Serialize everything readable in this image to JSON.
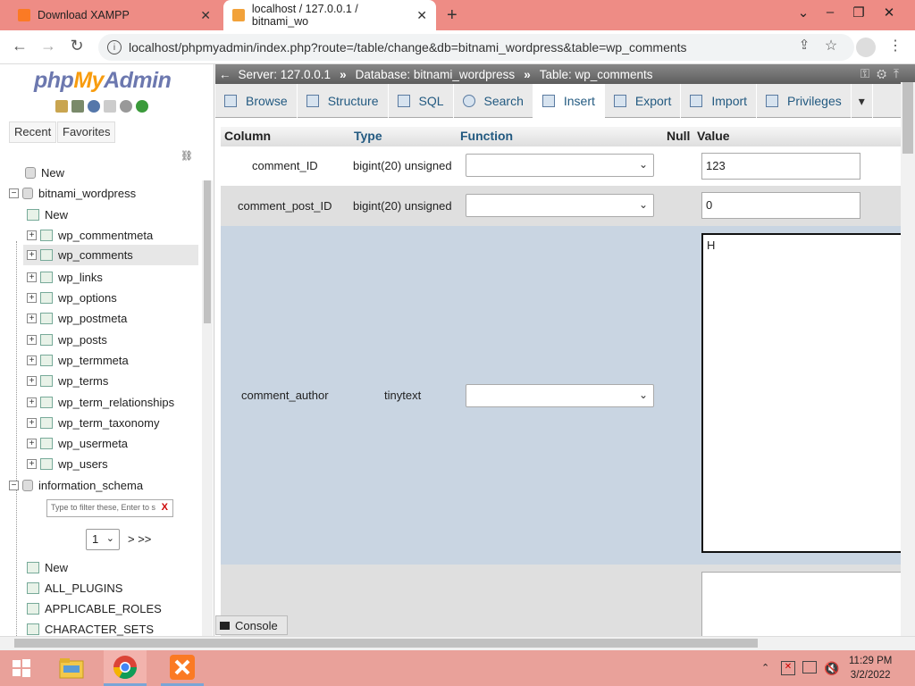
{
  "browser": {
    "tabs": [
      {
        "title": "Download XAMPP",
        "close": "✕"
      },
      {
        "title": "localhost / 127.0.0.1 / bitnami_wo",
        "close": "✕"
      }
    ],
    "new_tab": "+",
    "url": "localhost/phpmyadmin/index.php?route=/table/change&db=bitnami_wordpress&table=wp_comments",
    "window_controls": [
      "⌄",
      "–",
      "❐",
      "✕"
    ]
  },
  "pma": {
    "logo": {
      "php": "php",
      "my": "My",
      "admin": "Admin"
    },
    "nav_buttons": [
      "Recent",
      "Favorites"
    ],
    "tree": [
      {
        "label": "New",
        "level": 0
      },
      {
        "label": "bitnami_wordpress",
        "level": 0
      },
      {
        "label": "New",
        "level": 1
      },
      {
        "label": "wp_commentmeta",
        "level": 1
      },
      {
        "label": "wp_comments",
        "level": 1
      },
      {
        "label": "wp_links",
        "level": 1
      },
      {
        "label": "wp_options",
        "level": 1
      },
      {
        "label": "wp_postmeta",
        "level": 1
      },
      {
        "label": "wp_posts",
        "level": 1
      },
      {
        "label": "wp_termmeta",
        "level": 1
      },
      {
        "label": "wp_terms",
        "level": 1
      },
      {
        "label": "wp_term_relationships",
        "level": 1
      },
      {
        "label": "wp_term_taxonomy",
        "level": 1
      },
      {
        "label": "wp_usermeta",
        "level": 1
      },
      {
        "label": "wp_users",
        "level": 1
      },
      {
        "label": "information_schema",
        "level": 0
      }
    ],
    "filter_placeholder": "Type to filter these, Enter to s",
    "filter_clear": "X",
    "page_select": "1",
    "page_next": "> >>",
    "tree2": [
      {
        "label": "New"
      },
      {
        "label": "ALL_PLUGINS"
      },
      {
        "label": "APPLICABLE_ROLES"
      },
      {
        "label": "CHARACTER_SETS"
      }
    ],
    "breadcrumb": {
      "server": "Server: 127.0.0.1",
      "database": "Database: bitnami_wordpress",
      "table": "Table: wp_comments",
      "sep": "»"
    },
    "tabs": [
      "Browse",
      "Structure",
      "SQL",
      "Search",
      "Insert",
      "Export",
      "Import",
      "Privileges"
    ],
    "active_tab": "Insert",
    "columns_header": {
      "column": "Column",
      "type": "Type",
      "function": "Function",
      "null": "Null",
      "value": "Value"
    },
    "rows": [
      {
        "column": "comment_ID",
        "type": "bigint(20) unsigned",
        "function": "",
        "value": "123"
      },
      {
        "column": "comment_post_ID",
        "type": "bigint(20) unsigned",
        "function": "",
        "value": "0"
      },
      {
        "column": "comment_author",
        "type": "tinytext",
        "function": "",
        "value": "H"
      }
    ],
    "console_label": "Console"
  },
  "taskbar": {
    "time": "11:29 PM",
    "date": "3/2/2022"
  }
}
